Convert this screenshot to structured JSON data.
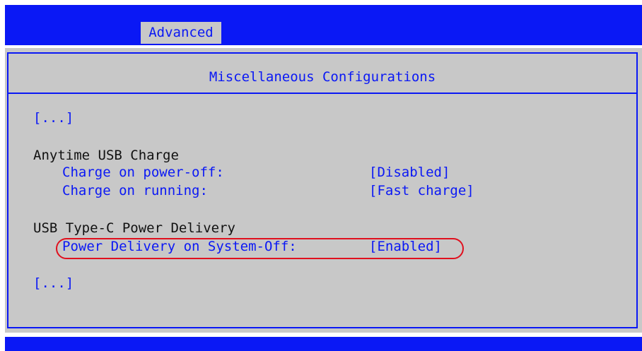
{
  "tabs": [
    {
      "label": "Advanced",
      "selected": true
    }
  ],
  "page": {
    "title": "Miscellaneous Configurations"
  },
  "ellipsis_top": "[...]",
  "ellipsis_bottom": "[...]",
  "sections": [
    {
      "heading": "Anytime USB Charge",
      "settings": [
        {
          "label": "Charge on power-off:",
          "value": "[Disabled]"
        },
        {
          "label": "Charge on running:",
          "value": "[Fast charge]"
        }
      ]
    },
    {
      "heading": "USB Type-C Power Delivery",
      "settings": [
        {
          "label": "Power Delivery on System-Off:",
          "value": "[Enabled]",
          "highlighted": true
        }
      ]
    }
  ],
  "colors": {
    "accent_blue": "#0a18f5",
    "panel_gray": "#c8c8c8",
    "heading_text": "#111111",
    "highlight_red": "#e0101e"
  }
}
